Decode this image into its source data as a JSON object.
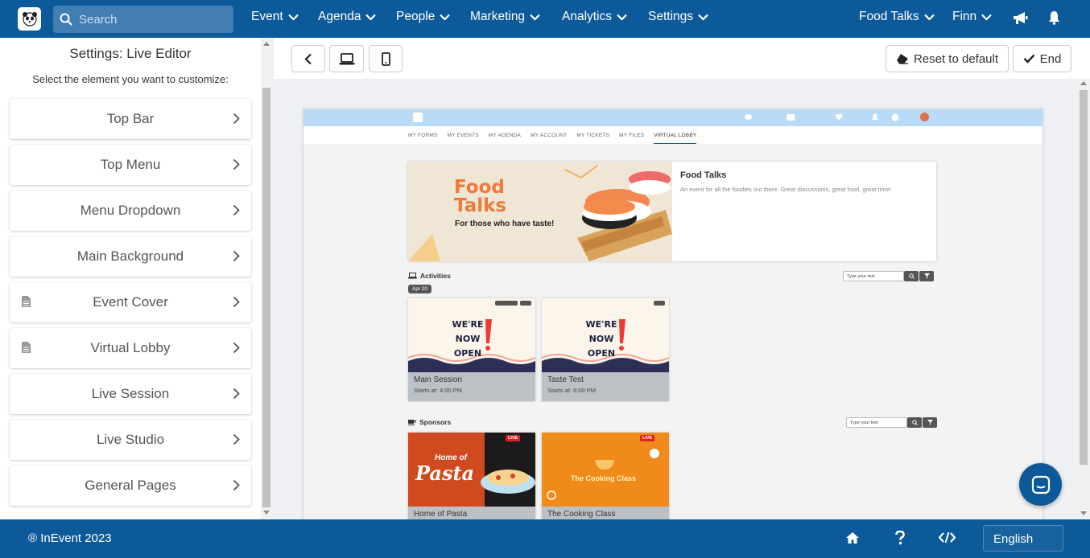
{
  "nav": {
    "search_placeholder": "Search",
    "items": [
      "Event",
      "Agenda",
      "People",
      "Marketing",
      "Analytics",
      "Settings"
    ],
    "event_name": "Food Talks",
    "user_name": "Finn"
  },
  "left_panel": {
    "title": "Settings: Live Editor",
    "subtitle": "Select the element you want to customize:",
    "items": [
      {
        "label": "Top Bar",
        "icon": ""
      },
      {
        "label": "Top Menu",
        "icon": ""
      },
      {
        "label": "Menu Dropdown",
        "icon": ""
      },
      {
        "label": "Main Background",
        "icon": ""
      },
      {
        "label": "Event Cover",
        "icon": "document-icon"
      },
      {
        "label": "Virtual Lobby",
        "icon": "document-icon"
      },
      {
        "label": "Live Session",
        "icon": ""
      },
      {
        "label": "Live Studio",
        "icon": ""
      },
      {
        "label": "General Pages",
        "icon": ""
      }
    ]
  },
  "toolbar": {
    "reset_label": "Reset to default",
    "end_label": "End"
  },
  "preview": {
    "menu": [
      "MY FORMS",
      "MY EVENTS",
      "MY AGENDA",
      "MY ACCOUNT",
      "MY TICKETS",
      "MY FILES",
      "VIRTUAL LOBBY"
    ],
    "cover": {
      "title": "Food Talks",
      "description": "An event for all the foodies out there. Great discussions, great food, great time!",
      "art_title_1": "Food",
      "art_title_2": "Talks",
      "art_tagline": "For those who have taste!"
    },
    "activities": {
      "label": "Activities",
      "date": "Apr 20",
      "search_placeholder": "Type your text",
      "cards": [
        {
          "name": "Main Session",
          "time": "Starts at: 4:00 PM",
          "art": "WE'RE NOW OPEN"
        },
        {
          "name": "Taste Test",
          "time": "Starts at: 6:00 PM",
          "art": "WE'RE NOW OPEN"
        }
      ]
    },
    "sponsors": {
      "label": "Sponsors",
      "search_placeholder": "Type your text",
      "cards": [
        {
          "name": "Home of Pasta",
          "art_1": "Home of",
          "art_2": "Pasta",
          "badge": "LIVE"
        },
        {
          "name": "The Cooking Class",
          "art_1": "The Cooking Class",
          "badge": "LIVE"
        }
      ]
    }
  },
  "footer": {
    "copyright": "® InEvent 2023",
    "language": "English"
  },
  "colors": {
    "brand": "#0d5a9b",
    "preview_topbar": "#b8dcf7"
  }
}
